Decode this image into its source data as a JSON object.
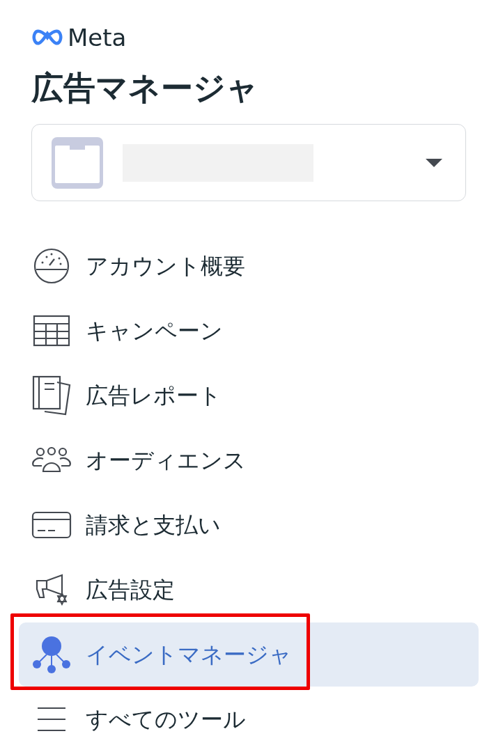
{
  "brand": {
    "name": "Meta"
  },
  "title": "広告マネージャ",
  "account_selector": {
    "expanded": false
  },
  "nav": [
    {
      "kind": "gauge",
      "label": "アカウント概要",
      "selected": false,
      "annotated": false
    },
    {
      "kind": "table",
      "label": "キャンペーン",
      "selected": false,
      "annotated": false
    },
    {
      "kind": "report",
      "label": "広告レポート",
      "selected": false,
      "annotated": false
    },
    {
      "kind": "people",
      "label": "オーディエンス",
      "selected": false,
      "annotated": false
    },
    {
      "kind": "card",
      "label": "請求と支払い",
      "selected": false,
      "annotated": false
    },
    {
      "kind": "megaphone",
      "label": "広告設定",
      "selected": false,
      "annotated": false
    },
    {
      "kind": "nodes",
      "label": "イベントマネージャ",
      "selected": true,
      "annotated": true
    },
    {
      "kind": "menu",
      "label": "すべてのツール",
      "selected": false,
      "annotated": false
    }
  ]
}
